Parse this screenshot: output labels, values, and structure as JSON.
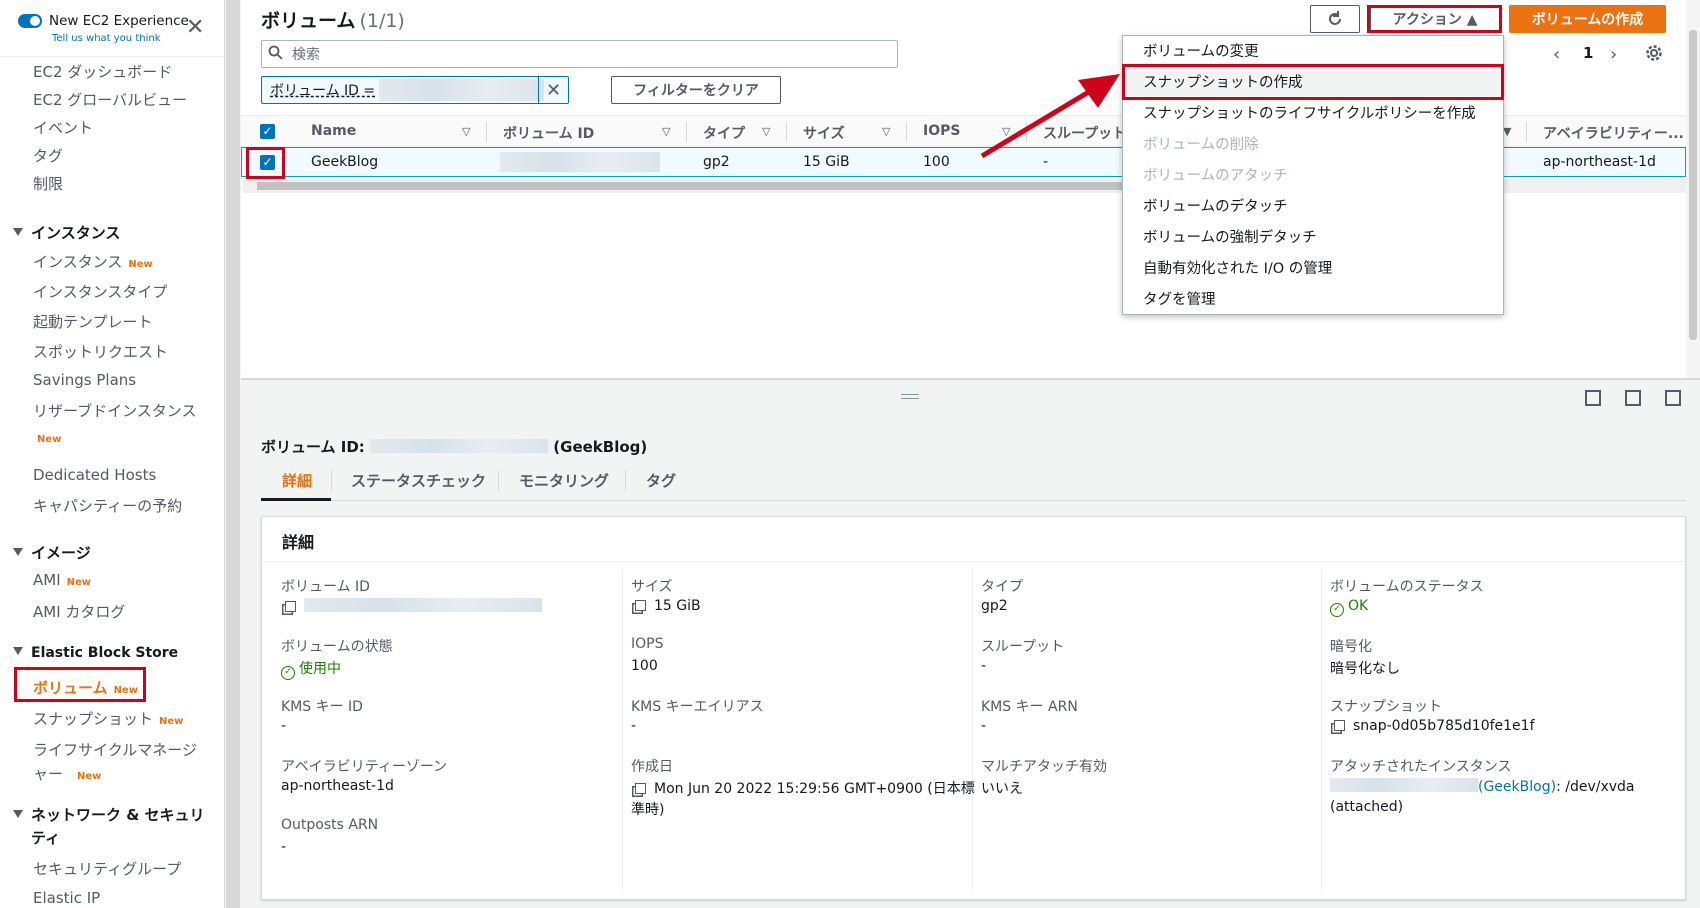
{
  "sidebar": {
    "new_experience_title": "New EC2 Experience",
    "new_experience_sub": "Tell us what you think",
    "top_items": [
      "EC2 ダッシュボード",
      "EC2 グローバルビュー",
      "イベント",
      "タグ",
      "制限"
    ],
    "section_instances": "インスタンス",
    "instances_items": [
      "インスタンス",
      "インスタンスタイプ",
      "起動テンプレート",
      "スポットリクエスト",
      "Savings Plans",
      "リザーブドインスタンス",
      "Dedicated Hosts",
      "キャパシティーの予約"
    ],
    "section_images": "イメージ",
    "images_items": [
      "AMI",
      "AMI カタログ"
    ],
    "section_ebs": "Elastic Block Store",
    "ebs_items": [
      "ボリューム",
      "スナップショット",
      "ライフサイクルマネージ",
      "ャー"
    ],
    "section_network": "ネットワーク & セキュリ",
    "section_network_2": "ティ",
    "network_items": [
      "セキュリティグループ",
      "Elastic IP"
    ],
    "new_badge": "New"
  },
  "header": {
    "title": "ボリューム",
    "count": "(1/1)",
    "actions_label": "アクション ▲",
    "create_label": "ボリュームの作成",
    "search_placeholder": "検索",
    "filter_label": "ボリューム ID =",
    "clear_filter_label": "フィルターをクリア",
    "page_number": "1"
  },
  "table": {
    "headers": [
      "Name",
      "ボリューム ID",
      "タイプ",
      "サイズ",
      "IOPS",
      "スループット",
      "アベイラビリティー..."
    ],
    "row": {
      "name": "GeekBlog",
      "type": "gp2",
      "size": "15 GiB",
      "iops": "100",
      "throughput": "-",
      "az": "ap-northeast-1d"
    }
  },
  "actions_menu": {
    "items": [
      "ボリュームの変更",
      "スナップショットの作成",
      "スナップショットのライフサイクルポリシーを作成",
      "ボリュームの削除",
      "ボリュームのアタッチ",
      "ボリュームのデタッチ",
      "ボリュームの強制デタッチ",
      "自動有効化された I/O の管理",
      "タグを管理"
    ],
    "disabled": [
      3,
      4
    ],
    "highlighted": 1
  },
  "detail": {
    "title_prefix": "ボリューム ID:",
    "title_suffix": "(GeekBlog)",
    "tabs": [
      "詳細",
      "ステータスチェック",
      "モニタリング",
      "タグ"
    ],
    "card_title": "詳細",
    "fields": {
      "volume_id_label": "ボリューム ID",
      "size_label": "サイズ",
      "size_value": "15 GiB",
      "type_label": "タイプ",
      "type_value": "gp2",
      "vol_status_label": "ボリュームのステータス",
      "vol_status_value": "OK",
      "state_label": "ボリュームの状態",
      "state_value": "使用中",
      "iops_label": "IOPS",
      "iops_value": "100",
      "throughput_label": "スループット",
      "throughput_value": "-",
      "encryption_label": "暗号化",
      "encryption_value": "暗号化なし",
      "kms_id_label": "KMS キー ID",
      "kms_id_value": "-",
      "kms_alias_label": "KMS キーエイリアス",
      "kms_alias_value": "-",
      "kms_arn_label": "KMS キー ARN",
      "kms_arn_value": "-",
      "snapshot_label": "スナップショット",
      "snapshot_value": "snap-0d05b785d10fe1e1f",
      "az_label": "アベイラビリティーゾーン",
      "az_value": "ap-northeast-1d",
      "created_label": "作成日",
      "created_value_1": "Mon Jun 20 2022 15:29:56 GMT+0900 (日本標",
      "created_value_2": "準時)",
      "multi_attach_label": "マルチアタッチ有効",
      "multi_attach_value": "いいえ",
      "attached_label": "アタッチされたインスタンス",
      "attached_link": "(GeekBlog)",
      "attached_value": ": /dev/xvda",
      "attached_state": "(attached)",
      "outposts_label": "Outposts ARN",
      "outposts_value": "-"
    }
  },
  "colors": {
    "accent": "#ec7211",
    "link": "#0073bb",
    "ok": "#1d8102",
    "highlight_box": "#d0021b"
  }
}
